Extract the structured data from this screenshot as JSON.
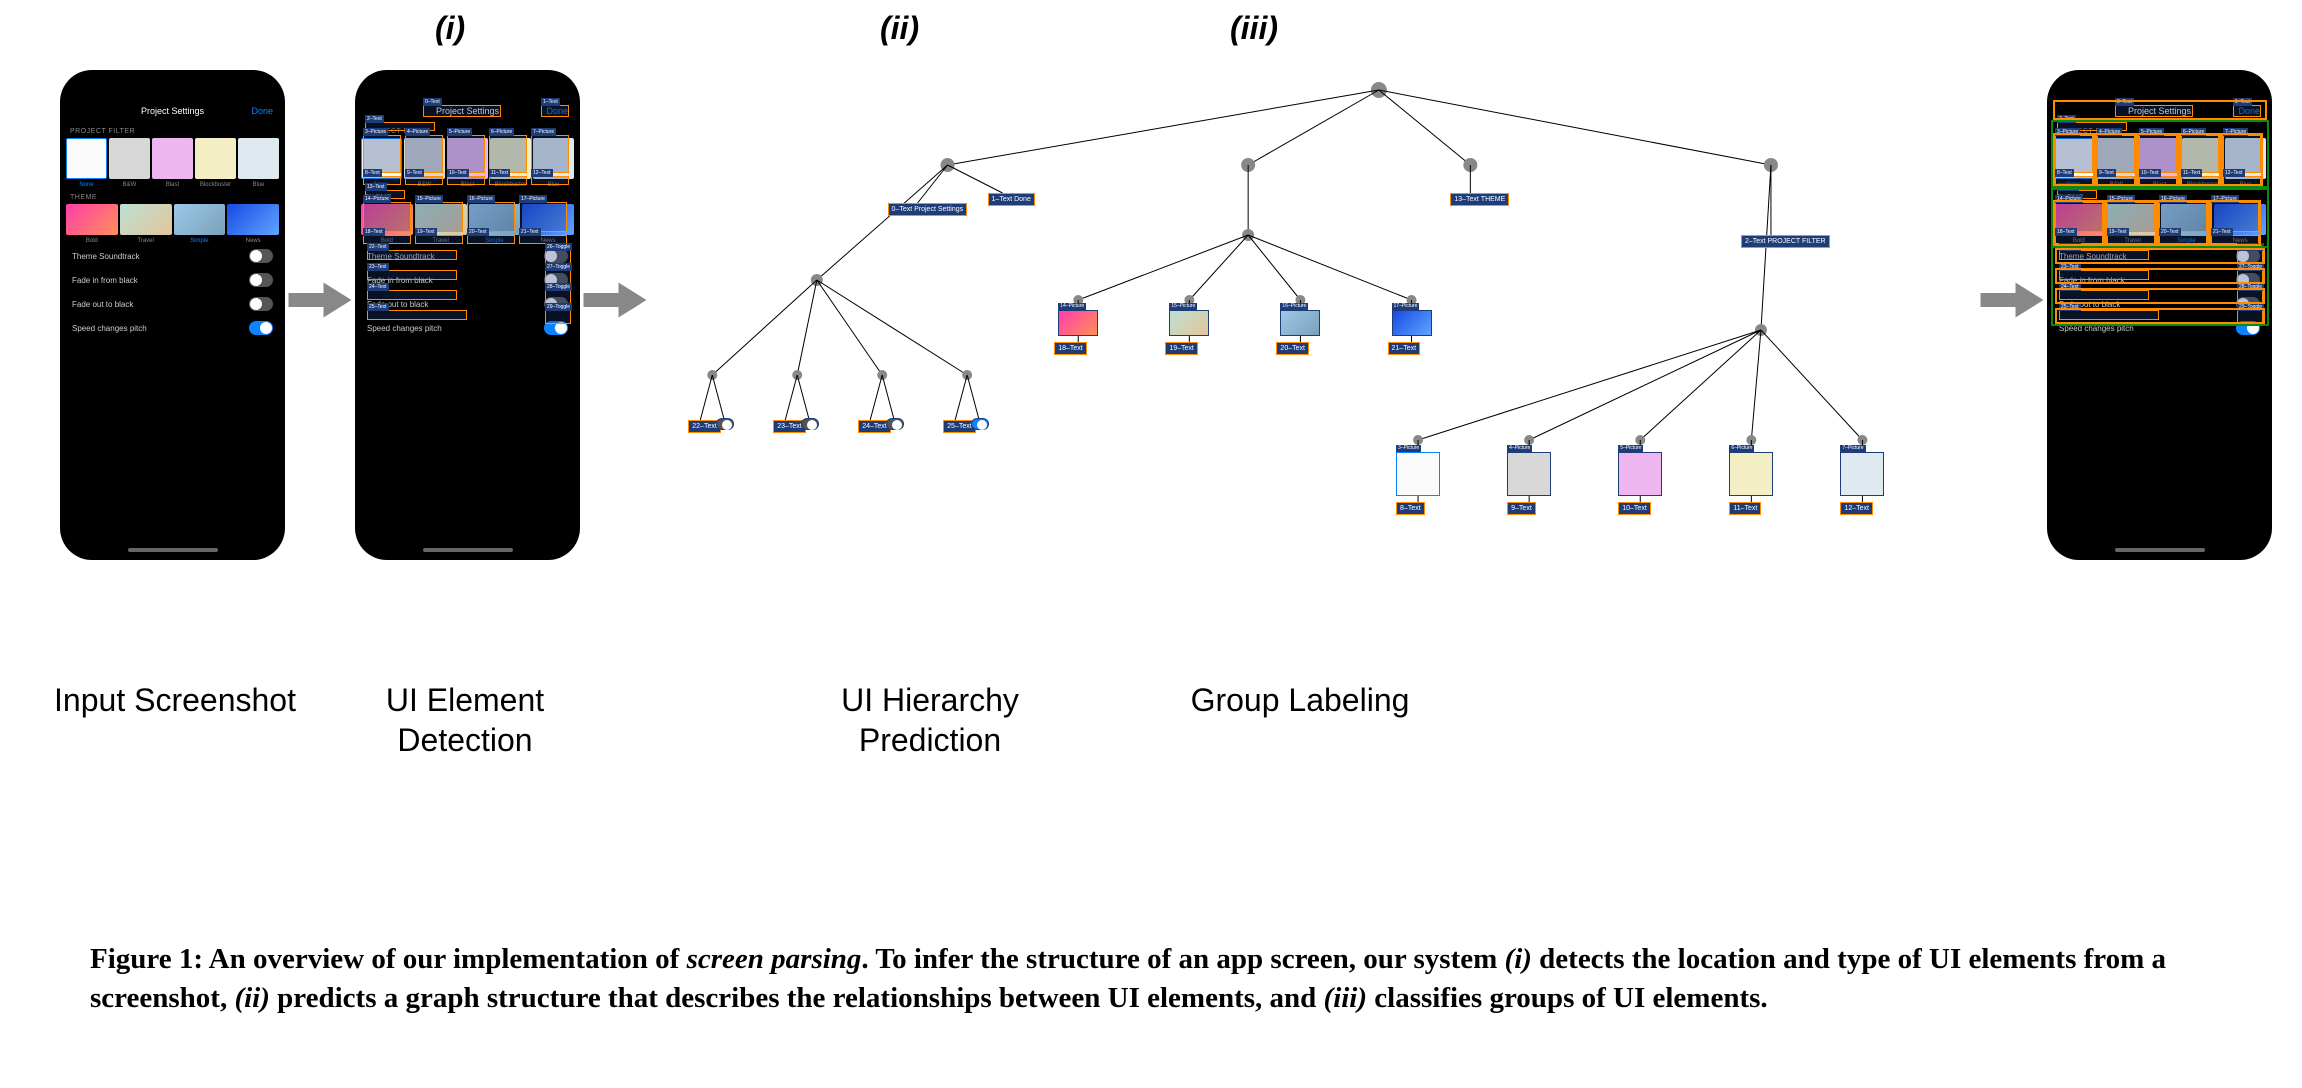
{
  "stage_numbers": {
    "i": "(i)",
    "ii": "(ii)",
    "iii": "(iii)"
  },
  "stage_labels": {
    "input": "Input Screenshot",
    "detection": "UI Element\nDetection",
    "hierarchy": "UI Hierarchy\nPrediction",
    "group": "Group Labeling"
  },
  "phone": {
    "title": "Project Settings",
    "done": "Done",
    "filter_section": "PROJECT FILTER",
    "filters": [
      {
        "name": "None",
        "color": "#fafafa",
        "selected": true,
        "border": "#0a84ff"
      },
      {
        "name": "B&W",
        "color": "#d8d8d8",
        "selected": false
      },
      {
        "name": "Blast",
        "color": "#eeb6ee",
        "selected": false
      },
      {
        "name": "Blockbuster",
        "color": "#f4eec4",
        "selected": false
      },
      {
        "name": "Blue",
        "color": "#dfe9f0",
        "selected": false
      }
    ],
    "theme_section": "THEME",
    "themes": [
      {
        "name": "Bold",
        "bg": "linear-gradient(135deg,#ff3da8,#ff8f5a)"
      },
      {
        "name": "Travel",
        "bg": "linear-gradient(135deg,#bde0d2,#e3c59b)"
      },
      {
        "name": "Simple",
        "bg": "linear-gradient(135deg,#9cc9e8,#7aa1b8)",
        "selected": true
      },
      {
        "name": "News",
        "bg": "linear-gradient(135deg,#1749e5,#5fa5ff)"
      }
    ],
    "toggles": [
      {
        "label": "Theme Soundtrack",
        "on": false,
        "knobRight": true
      },
      {
        "label": "Fade in from black",
        "on": false,
        "knobRight": true
      },
      {
        "label": "Fade out to black",
        "on": false,
        "knobRight": true
      },
      {
        "label": "Speed changes pitch",
        "on": true,
        "knobRight": true
      }
    ]
  },
  "detections": [
    {
      "id": 0,
      "type": "Text",
      "label": "Project Settings"
    },
    {
      "id": 1,
      "type": "Text",
      "label": "Done"
    },
    {
      "id": 2,
      "type": "Text",
      "label": "PROJECT FILTER"
    },
    {
      "id": 3,
      "type": "Picture"
    },
    {
      "id": 4,
      "type": "Picture"
    },
    {
      "id": 5,
      "type": "Picture"
    },
    {
      "id": 6,
      "type": "Picture"
    },
    {
      "id": 7,
      "type": "Picture"
    },
    {
      "id": 8,
      "type": "Text",
      "label": "None"
    },
    {
      "id": 9,
      "type": "Text",
      "label": "B&W"
    },
    {
      "id": 10,
      "type": "Text",
      "label": "Blast"
    },
    {
      "id": 11,
      "type": "Text",
      "label": "Blockbuster"
    },
    {
      "id": 12,
      "type": "Text",
      "label": "Blue"
    },
    {
      "id": 13,
      "type": "Text",
      "label": "THEME"
    },
    {
      "id": 14,
      "type": "Picture"
    },
    {
      "id": 15,
      "type": "Picture"
    },
    {
      "id": 16,
      "type": "Picture"
    },
    {
      "id": 17,
      "type": "Picture"
    },
    {
      "id": 18,
      "type": "Text",
      "label": "Bold"
    },
    {
      "id": 19,
      "type": "Text",
      "label": "Travel"
    },
    {
      "id": 20,
      "type": "Text",
      "label": "Simple"
    },
    {
      "id": 21,
      "type": "Text",
      "label": "News"
    },
    {
      "id": 22,
      "type": "Text",
      "label": "Theme Soundtrack"
    },
    {
      "id": 23,
      "type": "Text",
      "label": "Fade in from black"
    },
    {
      "id": 24,
      "type": "Text",
      "label": "Fade out to black"
    },
    {
      "id": 25,
      "type": "Text",
      "label": "Speed changes pitch"
    },
    {
      "id": 26,
      "type": "Toggle"
    },
    {
      "id": 27,
      "type": "Toggle"
    },
    {
      "id": 28,
      "type": "Toggle"
    },
    {
      "id": 29,
      "type": "Toggle"
    }
  ],
  "caption": {
    "figure_label": "Figure 1:",
    "text_before": " An overview of our implementation of ",
    "italic1": "screen parsing",
    "text_mid1": ". To infer the structure of an app screen, our system ",
    "italic_i": "(i)",
    "text_mid2": " detects the location and type of UI elements from a screenshot, ",
    "italic_ii": "(ii)",
    "text_mid3": " predicts a graph structure that describes the relationships between UI elements, and ",
    "italic_iii": "(iii)",
    "text_end": " classifies groups of UI elements."
  }
}
